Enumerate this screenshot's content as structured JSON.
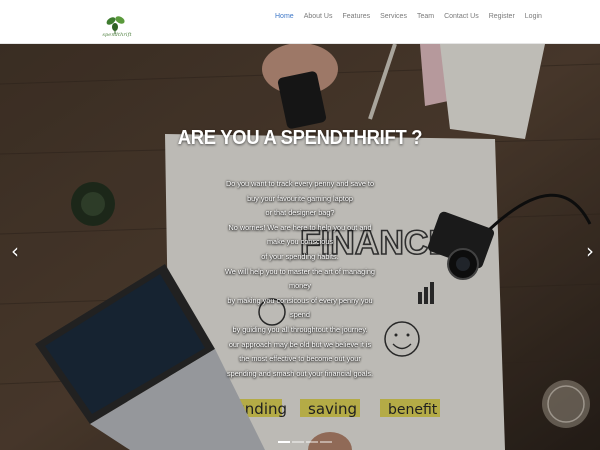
{
  "brand": {
    "logo_text": "spendthrift",
    "logo_color": "#4a7d3a"
  },
  "nav": {
    "active_color": "#3f78c8",
    "items": [
      {
        "label": "Home",
        "active": true
      },
      {
        "label": "About Us"
      },
      {
        "label": "Features"
      },
      {
        "label": "Services"
      },
      {
        "label": "Team"
      },
      {
        "label": "Contact Us"
      },
      {
        "label": "Register"
      },
      {
        "label": "Login"
      }
    ]
  },
  "hero": {
    "title": "ARE YOU A SPENDTHRIFT ?",
    "lines": [
      "Do you want to track every penny and save to",
      "buy your favourite gaming laptop",
      "or that designer bag?",
      "No worries! We are here to help you out and",
      "make you conscious",
      "of your spending habits.",
      "We will help you to master the art of managing",
      "money",
      "by making you consicous of every penny you",
      "spend",
      "by guiding you all throughtout the journey.",
      "our approach may be old but we believe it is",
      "the most effective to become out your",
      "spending and smash out your financial goals."
    ],
    "image_words": {
      "finance": "FINANCE",
      "funding": "funding",
      "saving": "saving",
      "benefit": "benefit"
    },
    "prev_icon": "chevron-left-icon",
    "next_icon": "chevron-right-icon",
    "slides_count": 4,
    "active_slide": 1
  }
}
